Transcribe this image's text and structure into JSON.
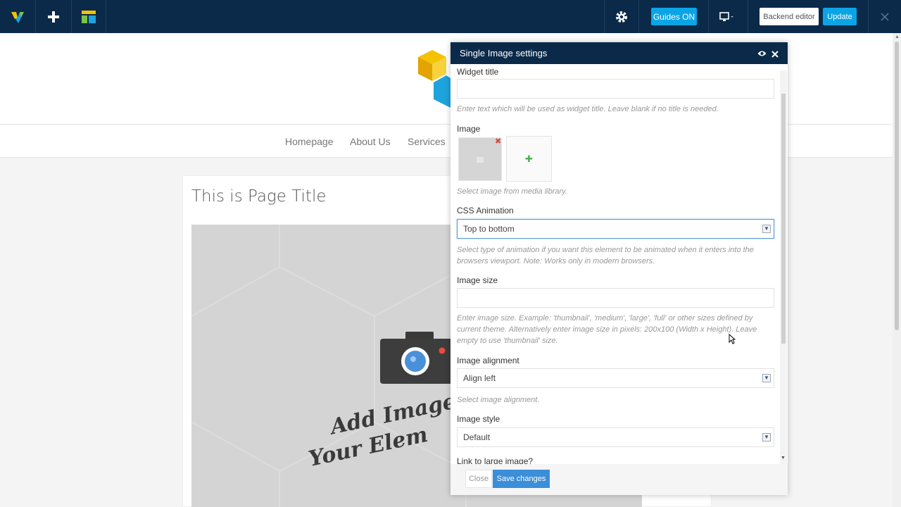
{
  "toolbar": {
    "guides_label": "Guides ON",
    "backend_label": "Backend editor",
    "update_label": "Update"
  },
  "nav": {
    "items": [
      "Homepage",
      "About Us",
      "Services"
    ]
  },
  "page": {
    "title": "This is Page Title",
    "placeholder_text_line1": "Add Image t",
    "placeholder_text_line2": "Your Elem"
  },
  "modal": {
    "title": "Single Image settings",
    "fields": {
      "widget_title_label": "Widget title",
      "widget_title_value": "",
      "widget_title_help": "Enter text which will be used as widget title. Leave blank if no title is needed.",
      "image_label": "Image",
      "image_help": "Select image from media library.",
      "css_animation_label": "CSS Animation",
      "css_animation_value": "Top to bottom",
      "css_animation_help": "Select type of animation if you want this element to be animated when it enters into the browsers viewport. Note: Works only in modern browsers.",
      "image_size_label": "Image size",
      "image_size_value": "",
      "image_size_help": "Enter image size. Example: 'thumbnail', 'medium', 'large', 'full' or other sizes defined by current theme. Alternatively enter image size in pixels: 200x100 (Width x Height). Leave empty to use 'thumbnail' size.",
      "image_alignment_label": "Image alignment",
      "image_alignment_value": "Align left",
      "image_alignment_help": "Select image alignment.",
      "image_style_label": "Image style",
      "image_style_value": "Default",
      "link_large_label": "Link to large image?"
    },
    "close_label": "Close",
    "save_label": "Save changes"
  },
  "colors": {
    "toolbar_bg": "#0b2a4a",
    "accent": "#0ba5e6",
    "save_button": "#3b8ed8"
  }
}
